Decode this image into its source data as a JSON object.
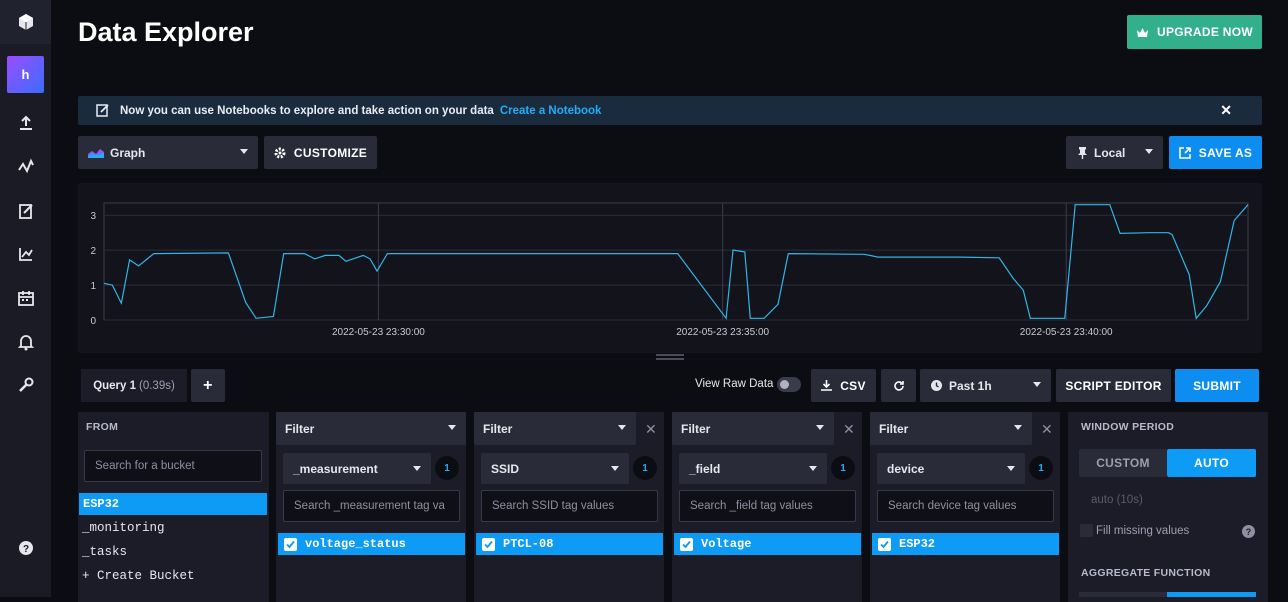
{
  "page": {
    "title": "Data Explorer"
  },
  "header": {
    "upgrade_label": "UPGRADE NOW"
  },
  "nav": {
    "org_initial": "h"
  },
  "banner": {
    "text": "Now you can use Notebooks to explore and take action on your data",
    "link": "Create a Notebook"
  },
  "toolbar": {
    "graph_type": "Graph",
    "customize_label": "CUSTOMIZE",
    "timezone": "Local",
    "save_as_label": "SAVE AS"
  },
  "chart_data": {
    "type": "line",
    "y_ticks": [
      "3",
      "2",
      "1",
      "0"
    ],
    "ylim": [
      0,
      3.35
    ],
    "x_ticks": [
      "2022-05-23 23:30:00",
      "2022-05-23 23:35:00",
      "2022-05-23 23:40:00"
    ],
    "grid": true,
    "series": [
      {
        "color": "#32b5e6",
        "points": [
          [
            0,
            1.05
          ],
          [
            0.12,
            1.0
          ],
          [
            0.25,
            0.48
          ],
          [
            0.37,
            1.72
          ],
          [
            0.5,
            1.55
          ],
          [
            0.72,
            1.9
          ],
          [
            1.8,
            1.92
          ],
          [
            2.05,
            0.5
          ],
          [
            2.2,
            0.05
          ],
          [
            2.45,
            0.1
          ],
          [
            2.6,
            1.9
          ],
          [
            2.9,
            1.9
          ],
          [
            3.05,
            1.75
          ],
          [
            3.2,
            1.85
          ],
          [
            3.4,
            1.85
          ],
          [
            3.5,
            1.68
          ],
          [
            3.75,
            1.85
          ],
          [
            3.85,
            1.75
          ],
          [
            3.95,
            1.4
          ],
          [
            4.1,
            1.9
          ],
          [
            8.3,
            1.9
          ],
          [
            9.0,
            0.05
          ],
          [
            9.1,
            2.0
          ],
          [
            9.27,
            1.95
          ],
          [
            9.35,
            0.05
          ],
          [
            9.55,
            0.05
          ],
          [
            9.75,
            0.45
          ],
          [
            9.9,
            1.9
          ],
          [
            11.0,
            1.88
          ],
          [
            11.2,
            1.8
          ],
          [
            11.7,
            1.8
          ],
          [
            12.4,
            1.8
          ],
          [
            12.95,
            1.78
          ],
          [
            13.15,
            1.2
          ],
          [
            13.3,
            0.85
          ],
          [
            13.4,
            0.05
          ],
          [
            13.9,
            0.05
          ],
          [
            14.05,
            3.3
          ],
          [
            14.55,
            3.3
          ],
          [
            14.7,
            2.48
          ],
          [
            15.1,
            2.5
          ],
          [
            15.4,
            2.5
          ],
          [
            15.45,
            2.45
          ],
          [
            15.7,
            1.3
          ],
          [
            15.8,
            0.05
          ],
          [
            15.95,
            0.4
          ],
          [
            16.15,
            1.1
          ],
          [
            16.35,
            2.85
          ],
          [
            16.55,
            3.3
          ]
        ]
      }
    ],
    "x_range": [
      0,
      16.55
    ],
    "x_tick_positions": [
      3.97,
      8.95,
      13.92
    ]
  },
  "query": {
    "tab_label": "Query 1",
    "tab_time": "(0.39s)",
    "add_label": "+",
    "view_raw_label": "View Raw Data",
    "csv_label": "CSV",
    "time_range": "Past 1h",
    "script_editor_label": "SCRIPT EDITOR",
    "submit_label": "SUBMIT"
  },
  "from": {
    "header": "FROM",
    "search_placeholder": "Search for a bucket",
    "buckets": [
      "ESP32",
      "_monitoring",
      "_tasks",
      "+ Create Bucket"
    ]
  },
  "filters": [
    {
      "label": "Filter",
      "key": "_measurement",
      "count": "1",
      "placeholder": "Search _measurement tag va",
      "selected": "voltage_status"
    },
    {
      "label": "Filter",
      "key": "SSID",
      "count": "1",
      "placeholder": "Search SSID tag values",
      "selected": "PTCL-08"
    },
    {
      "label": "Filter",
      "key": "_field",
      "count": "1",
      "placeholder": "Search _field tag values",
      "selected": "Voltage"
    },
    {
      "label": "Filter",
      "key": "device",
      "count": "1",
      "placeholder": "Search device tag values",
      "selected": "ESP32"
    }
  ],
  "window": {
    "header": "WINDOW PERIOD",
    "custom_label": "CUSTOM",
    "auto_label": "AUTO",
    "auto_value": "auto (10s)",
    "fill_missing": "Fill missing values",
    "aggregate_header": "AGGREGATE FUNCTION"
  }
}
